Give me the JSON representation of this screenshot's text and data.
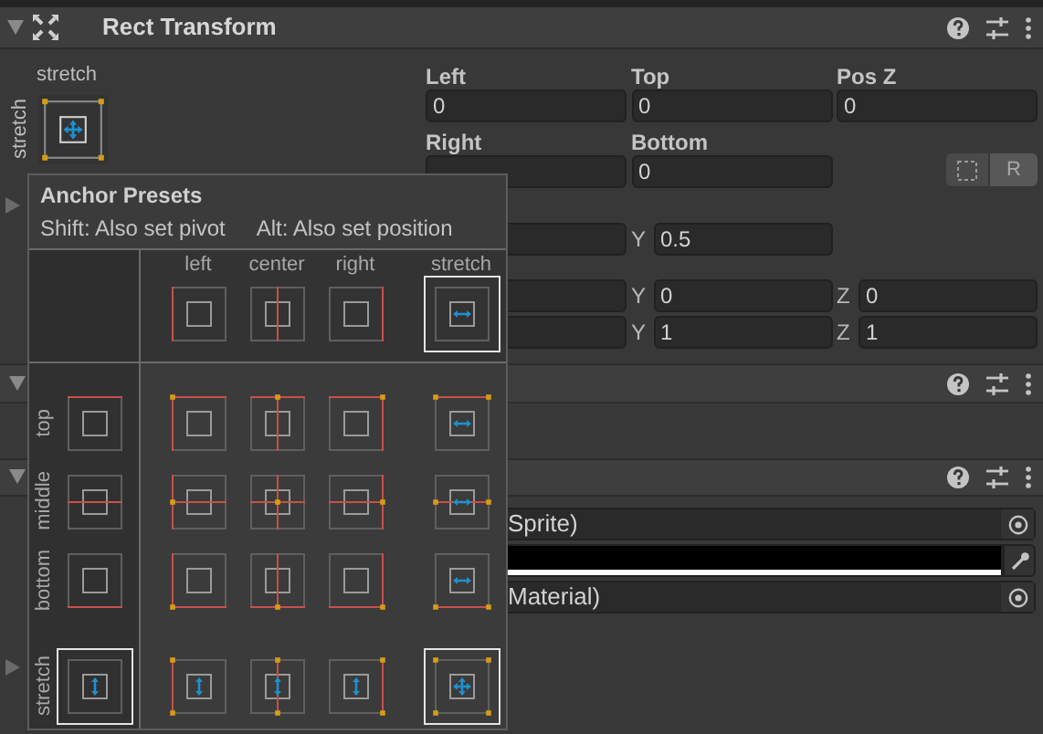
{
  "rect_transform": {
    "title": "Rect Transform",
    "expanded": true
  },
  "anchor": {
    "horizontal": {
      "label": "stretch",
      "kind": "stretch"
    },
    "vertical": {
      "label": "stretch",
      "kind": "stretch"
    }
  },
  "fields": [
    {
      "label": "Left",
      "value": "0"
    },
    {
      "label": "Top",
      "value": "0"
    },
    {
      "label": "Pos Z",
      "value": "0"
    },
    {
      "label": "Right"
    },
    {
      "label": "Bottom",
      "value": "0"
    }
  ],
  "edit_buttons": [
    {
      "kind": "blueprint"
    },
    {
      "kind": "raw",
      "label": "R"
    }
  ],
  "vector_rows": [
    {
      "fields": [
        {
          "axis": "Y",
          "value": "0.5"
        }
      ]
    },
    {
      "fields": [
        {
          "axis": "Y",
          "value": "0"
        },
        {
          "axis": "Z",
          "value": "0"
        }
      ]
    },
    {
      "fields": [
        {
          "axis": "Y",
          "value": "1"
        },
        {
          "axis": "Z",
          "value": "1"
        }
      ]
    }
  ],
  "foldouts": [
    {
      "expanded": false
    },
    {
      "expanded": false
    }
  ],
  "components": [
    {
      "expanded": true
    },
    {
      "expanded": true,
      "fields": [
        {
          "kind": "object",
          "value": "Sprite)"
        },
        {
          "kind": "color",
          "color": "#000000"
        },
        {
          "kind": "object",
          "value": "Material)"
        }
      ]
    }
  ],
  "anchor_presets": {
    "title": "Anchor Presets",
    "hint_shift": "Shift: Also set pivot",
    "hint_alt": "Alt: Also set position",
    "columns": [
      {
        "label": "left",
        "kind": "left",
        "selected": false
      },
      {
        "label": "center",
        "kind": "center",
        "selected": false
      },
      {
        "label": "right",
        "kind": "right",
        "selected": false
      },
      {
        "label": "stretch",
        "kind": "stretch",
        "selected": true
      }
    ],
    "rows": [
      {
        "label": "top",
        "kind": "top",
        "selected": false
      },
      {
        "label": "middle",
        "kind": "middle",
        "selected": false
      },
      {
        "label": "bottom",
        "kind": "bottom",
        "selected": false
      },
      {
        "label": "stretch",
        "kind": "stretch",
        "selected": true
      }
    ],
    "cells": [
      [
        {
          "selected": false
        },
        {
          "selected": false
        },
        {
          "selected": false
        },
        {
          "selected": false
        }
      ],
      [
        {
          "selected": false
        },
        {
          "selected": false
        },
        {
          "selected": false
        },
        {
          "selected": false
        }
      ],
      [
        {
          "selected": false
        },
        {
          "selected": false
        },
        {
          "selected": false
        },
        {
          "selected": false
        }
      ],
      [
        {
          "selected": false
        },
        {
          "selected": false
        },
        {
          "selected": false
        },
        {
          "selected": true
        }
      ]
    ]
  }
}
